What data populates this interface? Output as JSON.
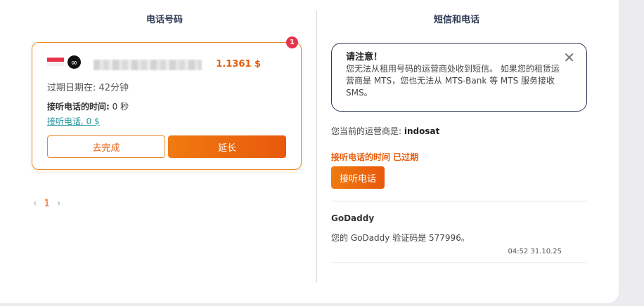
{
  "left": {
    "title": "电话号码",
    "badge_count": "1",
    "masked_number": "",
    "price": "1.1361 $",
    "expire_text": "过期日期在: 42分钟",
    "call_time_label": "接听电话的时间:",
    "call_time_value": " 0 秒",
    "call_link": "接听电话, 0 $",
    "btn_finish": "去完成",
    "btn_extend": "延长",
    "pagination": {
      "prev": "‹",
      "current": "1",
      "next": "›"
    }
  },
  "right": {
    "title": "短信和电话",
    "notice_title": "请注意！",
    "notice_body": "您无法从租用号码的运营商处收到短信。 如果您的租赁运营商是 MTS，您也无法从 MTS-Bank 等 MTS 服务接收 SMS。",
    "operator_label": "您当前的运营商是: ",
    "operator_value": "indosat",
    "expired_text": "接听电话的时间 已过期",
    "btn_call": "接听电话",
    "message": {
      "sender": "GoDaddy",
      "text": "您的 GoDaddy 验证码是 577996。",
      "time": "04:52 31.10.25"
    }
  },
  "colors": {
    "accent": "#e85c0a",
    "border": "#e98a2b",
    "badge": "#e8334a",
    "link": "#2a9aa0"
  }
}
